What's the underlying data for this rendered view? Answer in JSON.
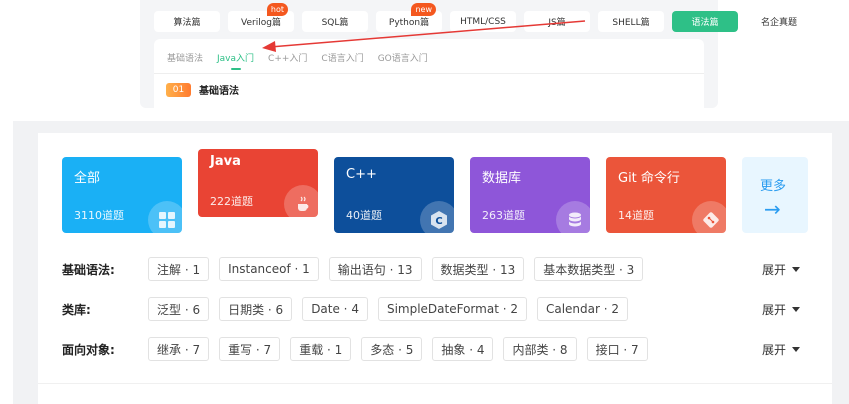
{
  "top": {
    "lang_tabs": [
      {
        "label": "算法篇",
        "badge": ""
      },
      {
        "label": "Verilog篇",
        "badge": "hot"
      },
      {
        "label": "SQL篇",
        "badge": ""
      },
      {
        "label": "Python篇",
        "badge": "new"
      },
      {
        "label": "HTML/CSS",
        "badge": ""
      },
      {
        "label": "JS篇",
        "badge": ""
      },
      {
        "label": "SHELL篇",
        "badge": ""
      },
      {
        "label": "语法篇",
        "badge": ""
      },
      {
        "label": "名企真题",
        "badge": ""
      }
    ],
    "active_lang_tab": "语法篇",
    "sub_tabs": [
      "基础语法",
      "Java入门",
      "C++入门",
      "C语言入门",
      "GO语言入门"
    ],
    "active_sub_tab": "Java入门",
    "section": {
      "number": "01",
      "title": "基础语法"
    }
  },
  "cards": [
    {
      "title": "全部",
      "count": "3110道题",
      "color": "#1ab0f5",
      "icon": "grid-icon"
    },
    {
      "title": "Java",
      "count": "222道题",
      "color": "#e94434",
      "icon": "java-cup-icon"
    },
    {
      "title": "C++",
      "count": "40道题",
      "color": "#0d4f9b",
      "icon": "cpp-icon"
    },
    {
      "title": "数据库",
      "count": "263道题",
      "color": "#8e56d9",
      "icon": "database-icon"
    },
    {
      "title": "Git 命令行",
      "count": "14道题",
      "color": "#eb553a",
      "icon": "git-icon"
    }
  ],
  "more_label": "更多",
  "filters": [
    {
      "label": "基础语法:",
      "tags": [
        "注解 · 1",
        "Instanceof · 1",
        "输出语句 · 13",
        "数据类型 · 13",
        "基本数据类型 · 3"
      ]
    },
    {
      "label": "类库:",
      "tags": [
        "泛型 · 6",
        "日期类 · 6",
        "Date · 4",
        "SimpleDateFormat · 2",
        "Calendar · 2"
      ]
    },
    {
      "label": "面向对象:",
      "tags": [
        "继承 · 7",
        "重写 · 7",
        "重载 · 1",
        "多态 · 5",
        "抽象 · 4",
        "内部类 · 8",
        "接口 · 7"
      ]
    }
  ],
  "expand_label": "展开",
  "colors": {
    "accent_green": "#2ec087",
    "badge_orange": "#f4581f",
    "arrow_red": "#e53935",
    "more_blue": "#2a9cf0"
  }
}
